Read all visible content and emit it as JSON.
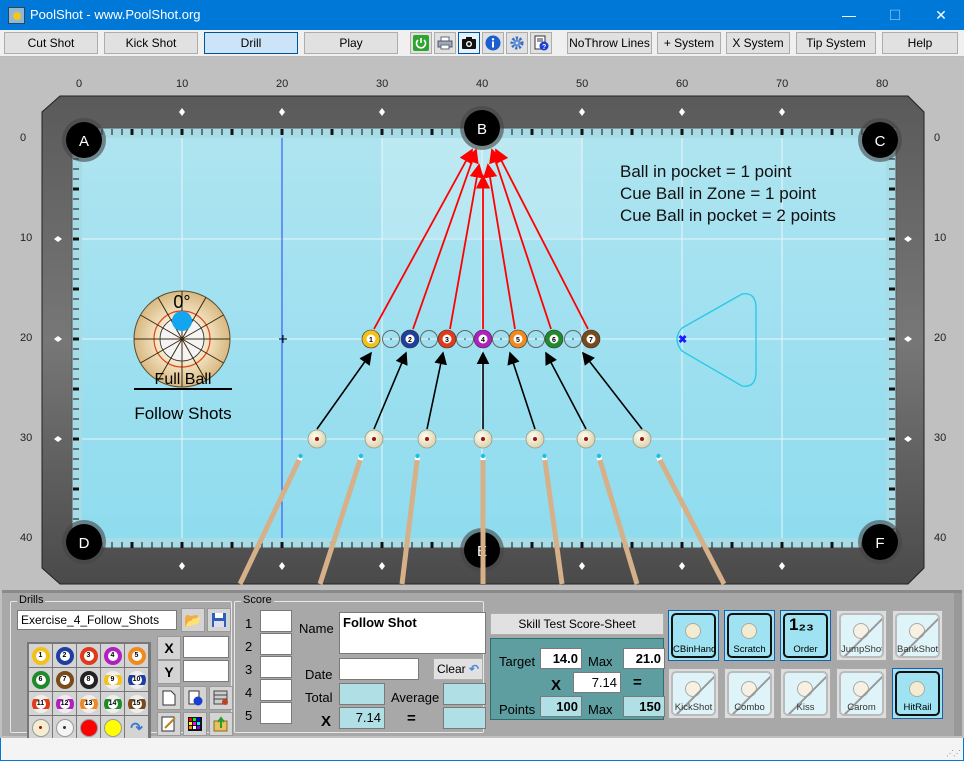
{
  "window": {
    "title": "PoolShot - www.PoolShot.org",
    "minimize": "—",
    "maximize": "☐",
    "close": "✕"
  },
  "toolbar": {
    "buttons": [
      "Cut Shot",
      "Kick Shot",
      "Drill",
      "Play"
    ],
    "active": "Drill",
    "icons": [
      "power-icon",
      "printer-icon",
      "camera-icon",
      "info-icon",
      "gear-icon",
      "help-document-icon"
    ],
    "right_buttons": [
      "NoThrow Lines",
      "+ System",
      "X System",
      "Tip System",
      "Help"
    ]
  },
  "table": {
    "x_ticks": [
      "0",
      "10",
      "20",
      "30",
      "40",
      "50",
      "60",
      "70",
      "80"
    ],
    "y_ticks": [
      "0",
      "10",
      "20",
      "30",
      "40"
    ],
    "pockets": [
      "A",
      "B",
      "C",
      "D",
      "E",
      "F"
    ],
    "scoring_text": [
      "Ball in pocket = 1 point",
      "Cue Ball in Zone = 1 point",
      "Cue Ball in pocket = 2 points"
    ],
    "aim_indicator": {
      "angle": "0°",
      "label": "Full Ball"
    },
    "drill_title": "Follow Shots",
    "object_balls": [
      "1",
      "2",
      "3",
      "4",
      "5",
      "6",
      "7"
    ],
    "cue_ball_count": 7
  },
  "drills": {
    "label": "Drills",
    "filename": "Exercise_4_Follow_Shots",
    "balls": [
      "1",
      "2",
      "3",
      "4",
      "5",
      "6",
      "7",
      "8",
      "9",
      "10",
      "11",
      "12",
      "13",
      "14",
      "15"
    ],
    "x_label": "X",
    "y_label": "Y",
    "x_value": "",
    "y_value": ""
  },
  "score": {
    "label": "Score",
    "rows": [
      "1",
      "2",
      "3",
      "4",
      "5"
    ],
    "name_label": "Name",
    "name_value": "Follow Shot",
    "date_label": "Date",
    "date_value": "",
    "clear_label": "Clear",
    "total_label": "Total",
    "average_label": "Average",
    "x_label": "X",
    "multiplier": "7.14",
    "equals": "="
  },
  "skill_test": {
    "button": "Skill Test Score-Sheet",
    "target_label": "Target",
    "target": "14.0",
    "max_label": "Max",
    "target_max": "21.0",
    "x_label": "X",
    "multiplier": "7.14",
    "equals": "=",
    "points_label": "Points",
    "points": "100",
    "points_max": "150"
  },
  "shot_types": [
    {
      "label": "CBinHand",
      "on": true
    },
    {
      "label": "Scratch",
      "on": true
    },
    {
      "label": "Order",
      "on": true
    },
    {
      "label": "JumpShot",
      "on": false
    },
    {
      "label": "BankShot",
      "on": false
    },
    {
      "label": "KickShot",
      "on": false
    },
    {
      "label": "Combo",
      "on": false
    },
    {
      "label": "Kiss",
      "on": false
    },
    {
      "label": "Carom",
      "on": false
    },
    {
      "label": "HitRail",
      "on": true
    }
  ],
  "colors": {
    "felt": "#9fdfee",
    "arrow_object": "#ff0000",
    "arrow_cue": "#000000",
    "accent": "#0078d7",
    "skill_panel": "#5f9ea0"
  }
}
